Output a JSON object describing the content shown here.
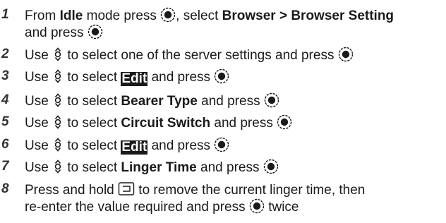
{
  "steps": [
    {
      "num": "1",
      "t1": "From ",
      "b1": "Idle",
      "t2": " mode press ",
      "t3": ", select ",
      "b2": "Browser > Browser Setting",
      "t4": "and press "
    },
    {
      "num": "2",
      "t1": "Use ",
      "t2": " to select one of the server settings and press "
    },
    {
      "num": "3",
      "t1": "Use ",
      "t2": " to select ",
      "hl": "Edit",
      "t3": " and press "
    },
    {
      "num": "4",
      "t1": "Use ",
      "t2": " to select ",
      "b1": "Bearer Type",
      "t3": " and press "
    },
    {
      "num": "5",
      "t1": "Use ",
      "t2": " to select ",
      "b1": "Circuit Switch",
      "t3": " and press "
    },
    {
      "num": "6",
      "t1": "Use ",
      "t2": " to select ",
      "hl": "Edit",
      "t3": " and press "
    },
    {
      "num": "7",
      "t1": "Use ",
      "t2": " to select ",
      "b1": "Linger Time",
      "t3": " and press "
    },
    {
      "num": "8",
      "t1": "Press and hold ",
      "t2": " to remove the current linger time, then",
      "t3": "re-enter the value required and press ",
      "t4": " twice"
    }
  ],
  "icons": {
    "select": "select-key-icon",
    "nav": "navigation-key-icon",
    "clear": "clear-key-icon"
  }
}
